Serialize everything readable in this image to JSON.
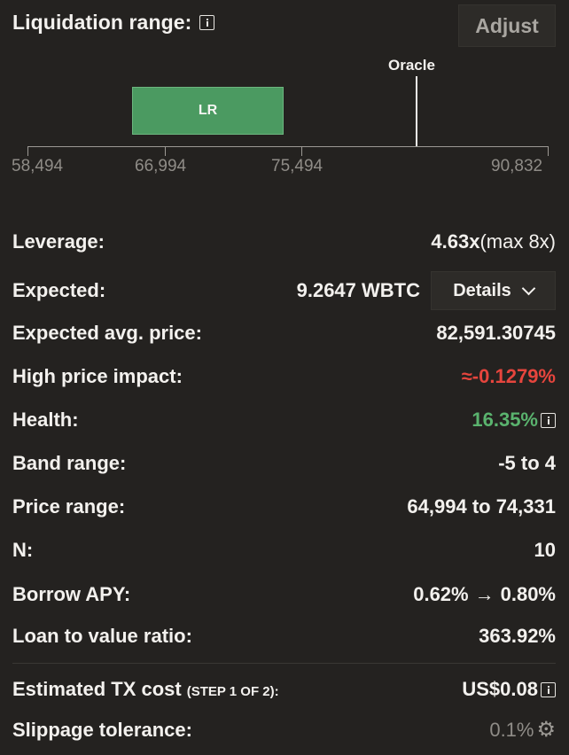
{
  "header": {
    "title": "Liquidation range:",
    "adjust_label": "Adjust"
  },
  "chart": {
    "oracle_label": "Oracle",
    "band_label": "LR",
    "ticks": [
      "58,494",
      "66,994",
      "75,494",
      "90,832"
    ]
  },
  "rows": {
    "leverage": {
      "label": "Leverage:",
      "value": "4.63x",
      "suffix": "(max 8x)"
    },
    "expected": {
      "label": "Expected:",
      "value": "9.2647 WBTC",
      "details_label": "Details"
    },
    "avg_price": {
      "label": "Expected avg. price:",
      "value": "82,591.30745"
    },
    "price_impact": {
      "label": "High price impact:",
      "value": "≈-0.1279%"
    },
    "health": {
      "label": "Health:",
      "value": "16.35%"
    },
    "band_range": {
      "label": "Band range:",
      "value": "-5 to 4"
    },
    "price_range": {
      "label": "Price range:",
      "value": "64,994 to 74,331"
    },
    "n": {
      "label": "N:",
      "value": "10"
    },
    "borrow_apy": {
      "label": "Borrow APY:",
      "from": "0.62%",
      "arrow": "→",
      "to": "0.80%"
    },
    "ltv": {
      "label": "Loan to value ratio:",
      "value": "363.92%"
    },
    "tx_cost": {
      "label": "Estimated TX cost",
      "step": "(STEP 1 OF 2):",
      "value": "US$0.08"
    },
    "slippage": {
      "label": "Slippage tolerance:",
      "value": "0.1%"
    }
  },
  "colors": {
    "accent_green": "#4b9a61",
    "danger_red": "#e6453d",
    "health_green": "#5ab36e"
  },
  "icons": {
    "info": "info-icon",
    "settings": "gear-icon",
    "dropdown": "chevron-down-icon"
  }
}
